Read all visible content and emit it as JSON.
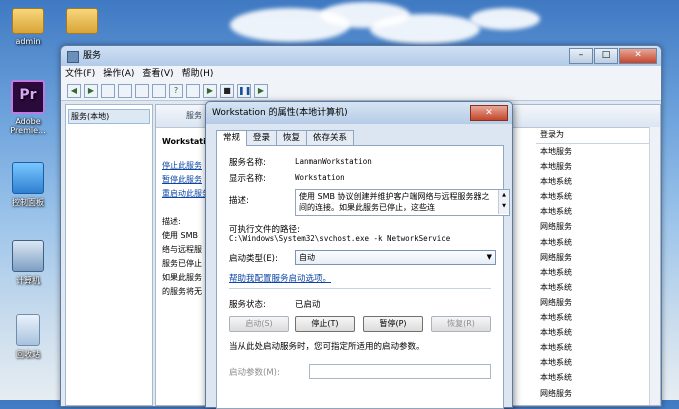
{
  "desktop": {
    "icons": [
      {
        "label": "admin",
        "icon": "user-folder-icon"
      },
      {
        "label": "",
        "icon": "folder-icon"
      },
      {
        "label": "Adobe Premie...",
        "icon": "premiere-icon"
      },
      {
        "label": "控制面板",
        "icon": "control-panel-icon"
      },
      {
        "label": "计算机",
        "icon": "computer-icon"
      },
      {
        "label": "回收站",
        "icon": "recycle-bin-icon"
      }
    ]
  },
  "services_window": {
    "title": "服务",
    "menu": [
      "文件(F)",
      "操作(A)",
      "查看(V)",
      "帮助(H)"
    ],
    "tree_item": "服务(本地)",
    "header": "服务",
    "selected_service": "Workstation",
    "links": [
      "停止此服务",
      "暂停此服务",
      "重启动此服务"
    ],
    "description_label": "描述:",
    "description_lines": [
      "使用 SMB",
      "络与远程服",
      "服务已停止",
      "如果此服务",
      "的服务将无"
    ],
    "logon_header": "登录为",
    "logon_values": [
      "本地服务",
      "本地服务",
      "本地系统",
      "本地系统",
      "本地系统",
      "网络服务",
      "本地系统",
      "网络服务",
      "本地系统",
      "本地系统",
      "网络服务",
      "本地系统",
      "本地系统",
      "本地系统",
      "本地系统",
      "本地系统",
      "网络服务"
    ]
  },
  "properties_dialog": {
    "title": "Workstation 的属性(本地计算机)",
    "tabs": [
      "常规",
      "登录",
      "恢复",
      "依存关系"
    ],
    "service_name_label": "服务名称:",
    "service_name": "LanmanWorkstation",
    "display_name_label": "显示名称:",
    "display_name": "Workstation",
    "description_label": "描述:",
    "description": "使用 SMB 协议创建并维护客户端网络与远程服务器之间的连接。如果此服务已停止，这些连",
    "exe_path_label": "可执行文件的路径:",
    "exe_path": "C:\\Windows\\System32\\svchost.exe -k NetworkService",
    "startup_type_label": "启动类型(E):",
    "startup_type": "自动",
    "help_link": "帮助我配置服务启动选项。",
    "status_label": "服务状态:",
    "status_value": "已启动",
    "buttons": {
      "start": "启动(S)",
      "stop": "停止(T)",
      "pause": "暂停(P)",
      "resume": "恢复(R)"
    },
    "hint": "当从此处启动服务时，您可指定所适用的启动参数。",
    "params_label": "启动参数(M):"
  }
}
